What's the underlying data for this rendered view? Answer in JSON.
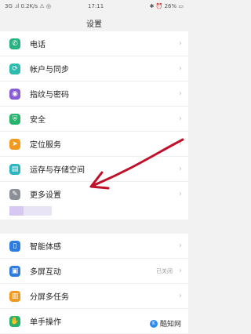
{
  "status": {
    "left": "3G .ıl 0.2K/s ⚠ ◎",
    "center": "17:11",
    "right": "✱ ⏰ 26% ▭"
  },
  "title": "设置",
  "groups": [
    {
      "items": [
        {
          "label": "电话",
          "icon": "phone-icon",
          "color": "#27b37f",
          "glyph": "✆"
        },
        {
          "label": "帐户与同步",
          "icon": "account-sync-icon",
          "color": "#2bbcad",
          "glyph": "⟳"
        },
        {
          "label": "指纹与密码",
          "icon": "fingerprint-icon",
          "color": "#8a5bd6",
          "glyph": "◉"
        },
        {
          "label": "安全",
          "icon": "shield-icon",
          "color": "#26b36c",
          "glyph": "⛨"
        },
        {
          "label": "定位服务",
          "icon": "location-icon",
          "color": "#f39a1e",
          "glyph": "➤"
        },
        {
          "label": "运存与存储空间",
          "icon": "storage-icon",
          "color": "#2bb6c2",
          "glyph": "▤"
        },
        {
          "label": "更多设置",
          "icon": "wrench-icon",
          "color": "#8a8f98",
          "glyph": "✎"
        }
      ]
    },
    {
      "items": [
        {
          "label": "智能体感",
          "icon": "smart-motion-icon",
          "color": "#2d7de0",
          "glyph": "▯"
        },
        {
          "label": "多屏互动",
          "icon": "multiscreen-icon",
          "color": "#2d7de0",
          "glyph": "▣",
          "value": "已关闭"
        },
        {
          "label": "分屏多任务",
          "icon": "split-screen-icon",
          "color": "#f39a1e",
          "glyph": "▥"
        },
        {
          "label": "单手操作",
          "icon": "one-hand-icon",
          "color": "#26b36c",
          "glyph": "✋"
        }
      ]
    }
  ],
  "watermark": {
    "text": "酷知网"
  },
  "colors": {
    "arrow": "#c0102a"
  }
}
